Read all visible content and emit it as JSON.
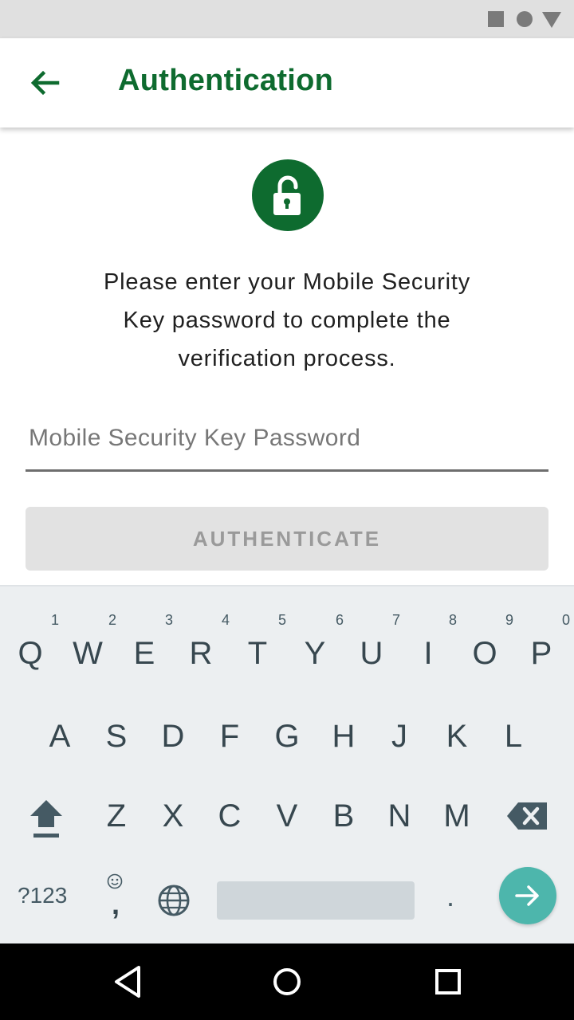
{
  "app": {
    "title": "Authentication"
  },
  "colors": {
    "brand_green": "#0e6b2f",
    "enter_key": "#4db6ac",
    "button_disabled_bg": "#e2e2e2"
  },
  "icons": {
    "back": "arrow-left",
    "lock": "unlocked-padlock",
    "shift": "shift-up-arrow",
    "backspace": "backspace",
    "globe": "globe",
    "enter": "arrow-right",
    "nav_back": "triangle-back",
    "nav_home": "circle-home",
    "nav_recents": "square-recents"
  },
  "main": {
    "message_lines": [
      "Please enter your Mobile Security",
      "Key password to complete the",
      "verification process."
    ],
    "password_placeholder": "Mobile Security Key Password",
    "password_value": "",
    "auth_button_label": "AUTHENTICATE"
  },
  "keyboard": {
    "row1": [
      {
        "letter": "Q",
        "num": "1"
      },
      {
        "letter": "W",
        "num": "2"
      },
      {
        "letter": "E",
        "num": "3"
      },
      {
        "letter": "R",
        "num": "4"
      },
      {
        "letter": "T",
        "num": "5"
      },
      {
        "letter": "Y",
        "num": "6"
      },
      {
        "letter": "U",
        "num": "7"
      },
      {
        "letter": "I",
        "num": "8"
      },
      {
        "letter": "O",
        "num": "9"
      },
      {
        "letter": "P",
        "num": "0"
      }
    ],
    "row2": [
      "A",
      "S",
      "D",
      "F",
      "G",
      "H",
      "J",
      "K",
      "L"
    ],
    "row3": [
      "Z",
      "X",
      "C",
      "V",
      "B",
      "N",
      "M"
    ],
    "symbols_label": "?123",
    "comma_label": ",",
    "period_label": "."
  }
}
